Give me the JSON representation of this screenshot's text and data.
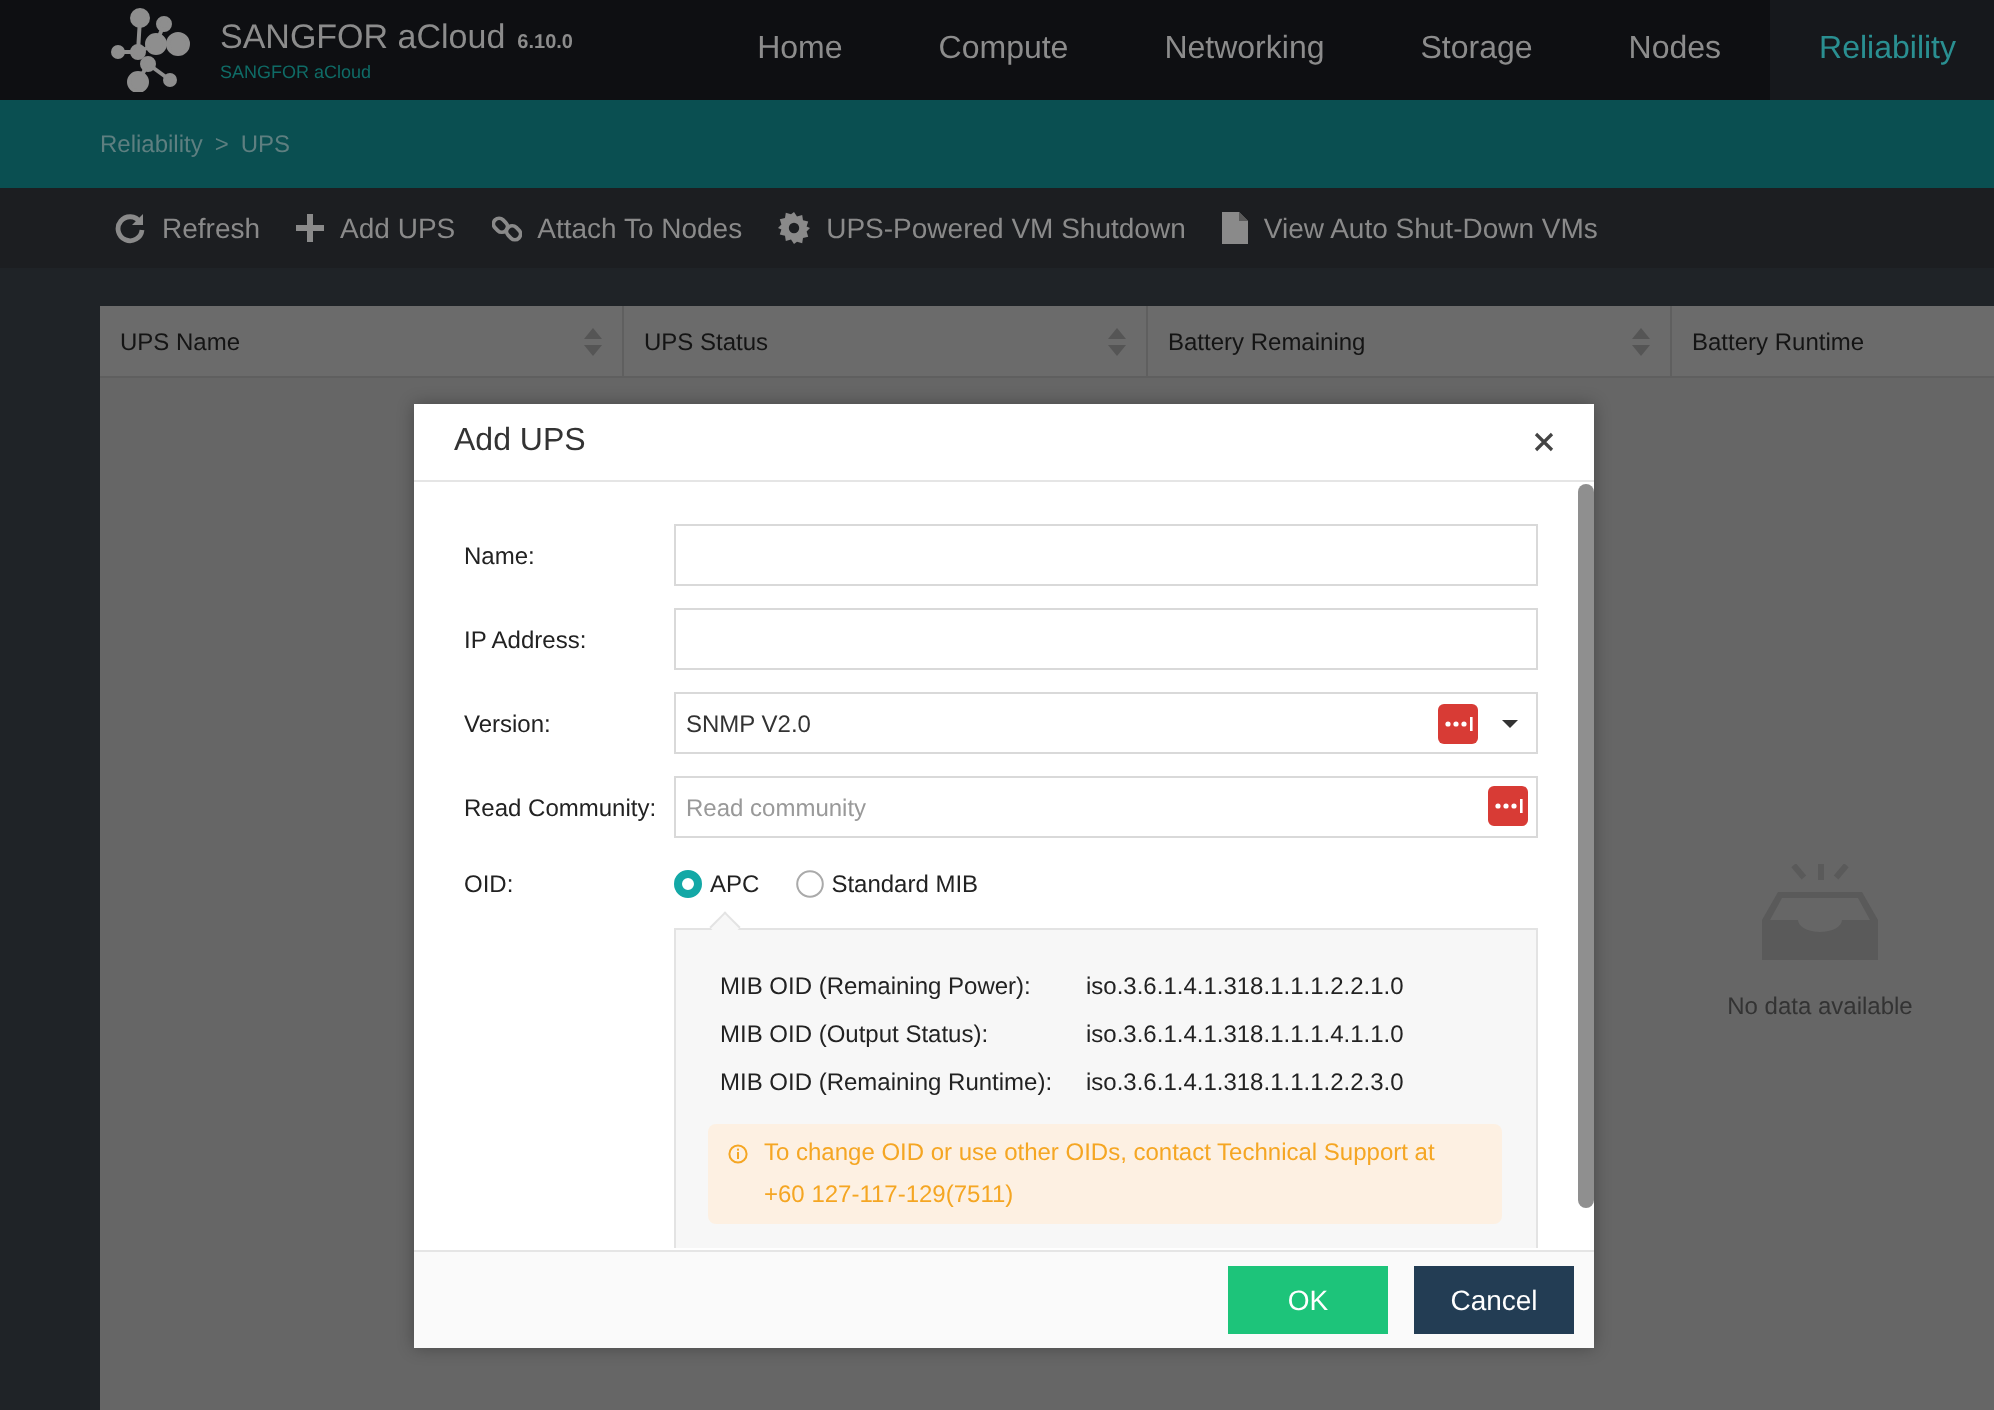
{
  "header": {
    "brand": "SANGFOR aCloud",
    "version": "6.10.0",
    "subtitle": "SANGFOR aCloud",
    "nav": [
      {
        "label": "Home",
        "selected": false
      },
      {
        "label": "Compute",
        "selected": false
      },
      {
        "label": "Networking",
        "selected": false
      },
      {
        "label": "Storage",
        "selected": false
      },
      {
        "label": "Nodes",
        "selected": false
      },
      {
        "label": "Reliability",
        "selected": true
      }
    ]
  },
  "breadcrumb": {
    "items": [
      "Reliability",
      "UPS"
    ],
    "separator": ">"
  },
  "toolbar": [
    {
      "label": "Refresh",
      "kind": "refresh"
    },
    {
      "label": "Add UPS",
      "kind": "add"
    },
    {
      "label": "Attach To Nodes",
      "kind": "attach"
    },
    {
      "label": "UPS-Powered VM Shutdown",
      "kind": "settings"
    },
    {
      "label": "View Auto Shut-Down VMs",
      "kind": "view"
    }
  ],
  "table": {
    "columns": [
      {
        "label": "UPS Name",
        "sortable": true
      },
      {
        "label": "UPS Status",
        "sortable": true
      },
      {
        "label": "Battery Remaining",
        "sortable": true
      },
      {
        "label": "Battery Runtime",
        "sortable": false
      }
    ],
    "empty_text": "No data available"
  },
  "dialog": {
    "title": "Add UPS",
    "fields": [
      {
        "kind": "text",
        "label": "Name:"
      },
      {
        "kind": "text",
        "label": "IP Address:"
      },
      {
        "kind": "select",
        "label": "Version:",
        "value": "SNMP V2.0"
      },
      {
        "kind": "secret",
        "label": "Read Community:",
        "placeholder": "Read community"
      }
    ],
    "oid": {
      "label": "OID:",
      "options": [
        {
          "label": "APC",
          "selected": true
        },
        {
          "label": "Standard MIB",
          "selected": false
        }
      ],
      "rows": [
        {
          "name": "MIB OID (Remaining Power):",
          "value": "iso.3.6.1.4.1.318.1.1.1.2.2.1.0"
        },
        {
          "name": "MIB OID (Output Status):",
          "value": "iso.3.6.1.4.1.318.1.1.1.4.1.1.0"
        },
        {
          "name": "MIB OID (Remaining Runtime):",
          "value": "iso.3.6.1.4.1.318.1.1.1.2.2.3.0"
        }
      ],
      "notice": "To change OID or use other OIDs, contact Technical Support at +60 127-117-129(7511)"
    },
    "buttons": [
      {
        "label": "OK",
        "kind": "primary"
      },
      {
        "label": "Cancel",
        "kind": "secondary"
      }
    ]
  }
}
